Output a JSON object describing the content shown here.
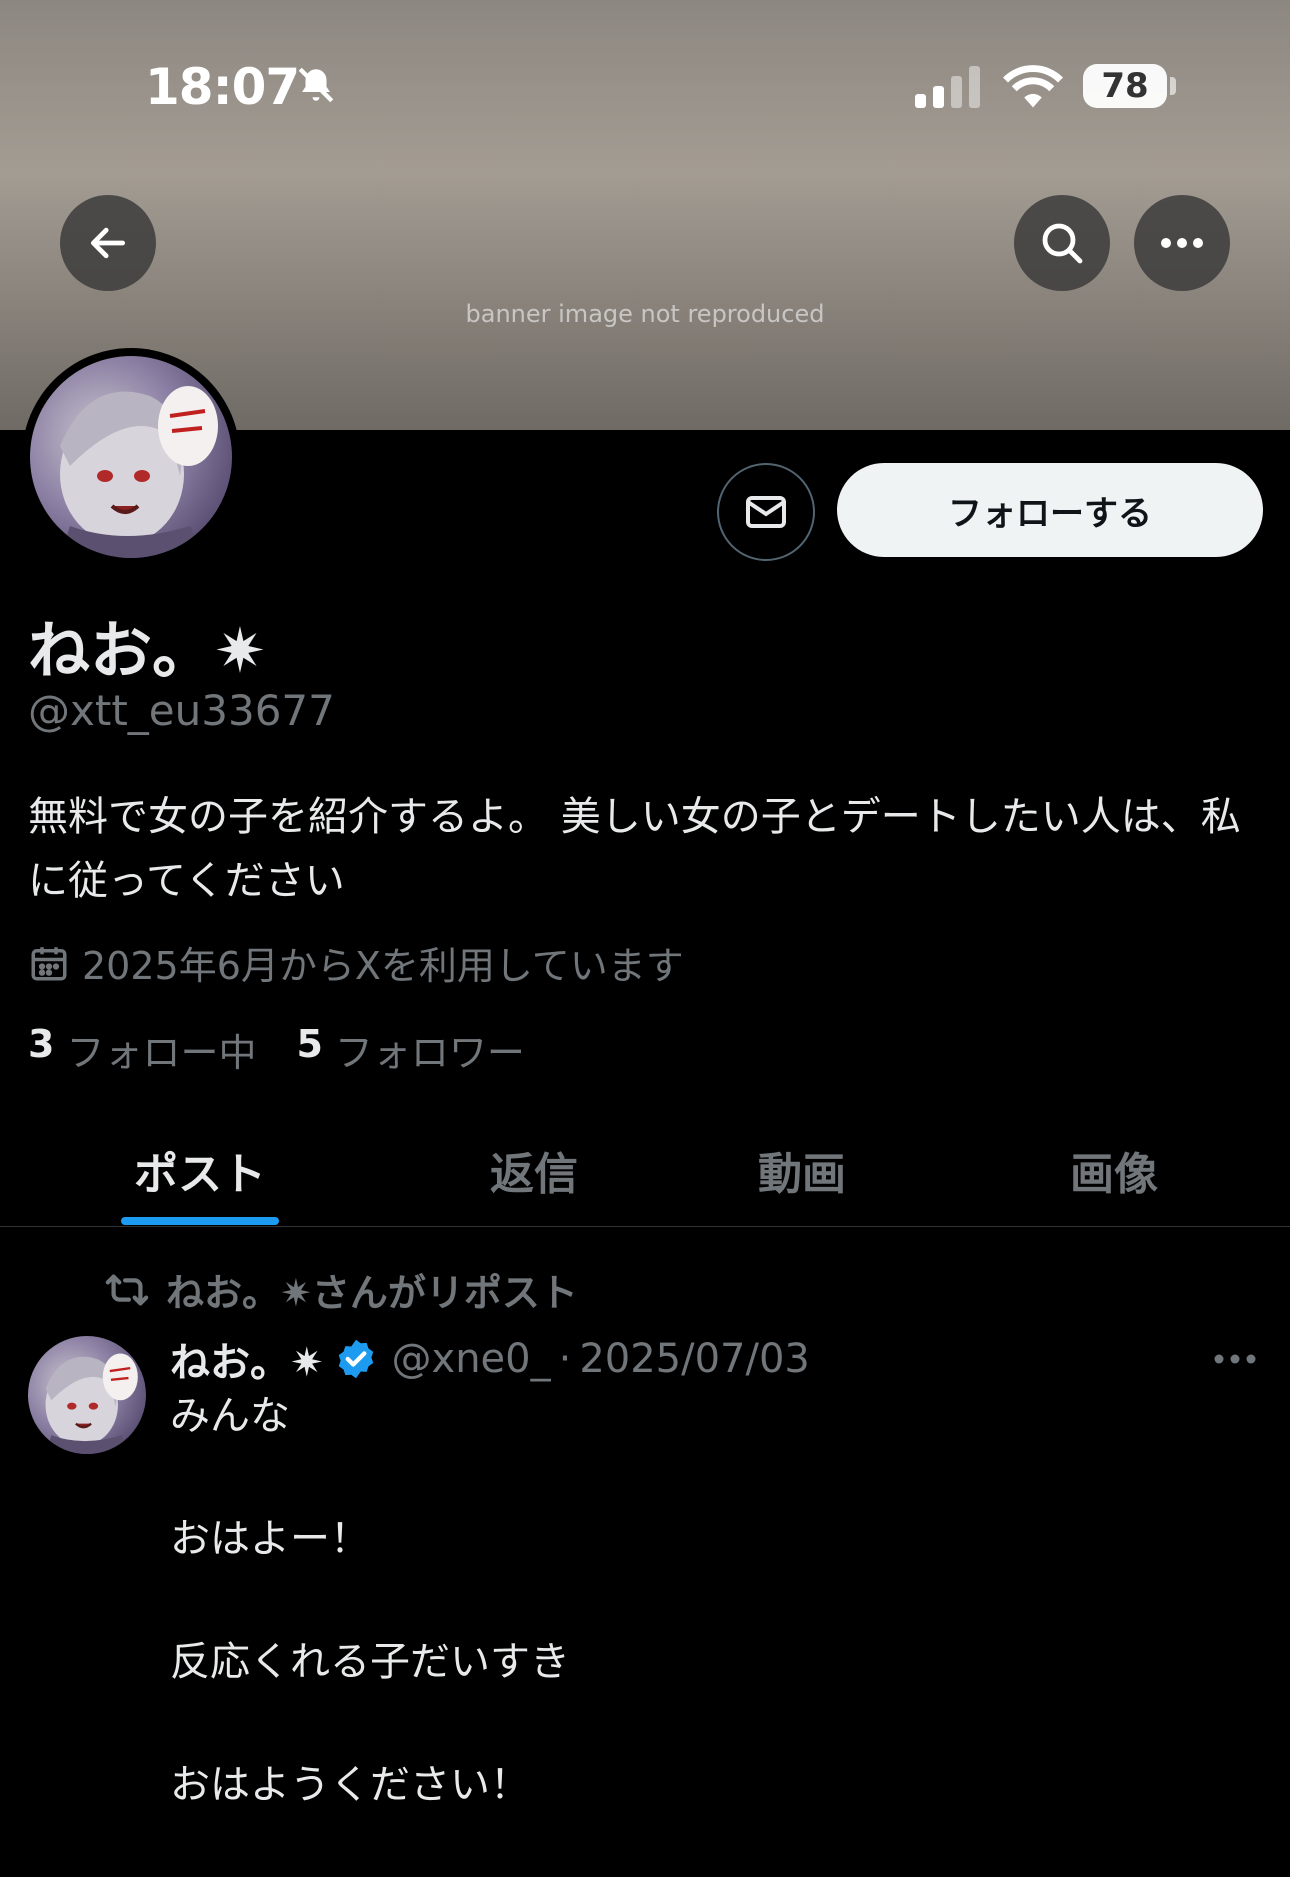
{
  "status_bar": {
    "time": "18:07",
    "battery": "78",
    "icons": [
      "bell-muted-icon",
      "signal-icon",
      "wifi-icon",
      "battery-icon"
    ]
  },
  "header": {
    "banner_note": "banner image not reproduced",
    "icons": [
      "back-arrow-icon",
      "search-icon",
      "more-icon"
    ]
  },
  "profile": {
    "display_name": "ねお。✷",
    "handle": "@xtt_eu33677",
    "bio": "無料で女の子を紹介するよ。 美しい女の子とデートしたい人は、私に従ってください",
    "joined": "2025年6月からXを利用しています",
    "following_count": "3",
    "following_label": "フォロー中",
    "followers_count": "5",
    "followers_label": "フォロワー",
    "follow_button": "フォローする",
    "icons": [
      "mail-icon",
      "calendar-icon"
    ]
  },
  "tabs": [
    {
      "label": "ポスト",
      "active": true
    },
    {
      "label": "返信",
      "active": false
    },
    {
      "label": "動画",
      "active": false
    },
    {
      "label": "画像",
      "active": false
    }
  ],
  "post": {
    "repost_label": "ねお。✷さんがリポスト",
    "author_name": "ねお。✷",
    "author_handle": "@xne0_",
    "separator": "·",
    "date": "2025/07/03",
    "lines": [
      "みんな",
      "おはよー！",
      "反応くれる子だいすき",
      "おはようください！"
    ],
    "verified_color": "#1d9bf0"
  },
  "colors": {
    "accent": "#1d9bf0",
    "muted_text": "#71767b",
    "text": "#e7e9ea",
    "background": "#000000"
  }
}
